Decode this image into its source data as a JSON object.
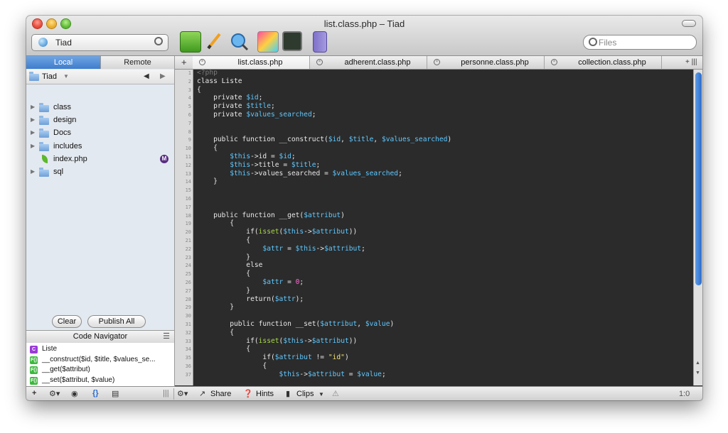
{
  "window": {
    "title": "list.class.php – Tiad"
  },
  "toolbar": {
    "site_name": "Tiad",
    "search_placeholder": "Files",
    "icons": [
      "leaf-icon",
      "pencil-icon",
      "preview-icon",
      "css-icon",
      "terminal-icon",
      "books-icon"
    ]
  },
  "sidebar": {
    "tabs": {
      "local": "Local",
      "remote": "Remote"
    },
    "path": "Tiad",
    "files": [
      {
        "name": "class",
        "kind": "folder"
      },
      {
        "name": "design",
        "kind": "folder"
      },
      {
        "name": "Docs",
        "kind": "folder"
      },
      {
        "name": "includes",
        "kind": "folder"
      },
      {
        "name": "index.php",
        "kind": "php",
        "badge": "M"
      },
      {
        "name": "sql",
        "kind": "folder"
      }
    ],
    "buttons": {
      "clear": "Clear",
      "publish": "Publish All"
    }
  },
  "navigator": {
    "title": "Code Navigator",
    "items": [
      {
        "badge": "C",
        "text": "Liste"
      },
      {
        "badge": "F()",
        "text": "__construct($id, $title, $values_se..."
      },
      {
        "badge": "F()",
        "text": "__get($attribut)"
      },
      {
        "badge": "F()",
        "text": "__set($attribut, $value)"
      }
    ]
  },
  "tabs": [
    {
      "label": "list.class.php",
      "active": true
    },
    {
      "label": "adherent.class.php",
      "active": false
    },
    {
      "label": "personne.class.php",
      "active": false
    },
    {
      "label": "collection.class.php",
      "active": false
    }
  ],
  "tabbar": {
    "add": "+",
    "overflow": "+ |||"
  },
  "code": {
    "lines": [
      [
        {
          "t": "<?php",
          "c": "dim"
        }
      ],
      [
        {
          "t": "class Liste",
          "c": "plain"
        }
      ],
      [
        {
          "t": "{",
          "c": "plain"
        }
      ],
      [
        {
          "t": "    private ",
          "c": "plain"
        },
        {
          "t": "$id",
          "c": "var"
        },
        {
          "t": ";",
          "c": "plain"
        }
      ],
      [
        {
          "t": "    private ",
          "c": "plain"
        },
        {
          "t": "$title",
          "c": "var"
        },
        {
          "t": ";",
          "c": "plain"
        }
      ],
      [
        {
          "t": "    private ",
          "c": "plain"
        },
        {
          "t": "$values_searched",
          "c": "var"
        },
        {
          "t": ";",
          "c": "plain"
        }
      ],
      [],
      [],
      [
        {
          "t": "    public function __construct(",
          "c": "plain"
        },
        {
          "t": "$id",
          "c": "var"
        },
        {
          "t": ", ",
          "c": "plain"
        },
        {
          "t": "$title",
          "c": "var"
        },
        {
          "t": ", ",
          "c": "plain"
        },
        {
          "t": "$values_searched",
          "c": "var"
        },
        {
          "t": ")",
          "c": "plain"
        }
      ],
      [
        {
          "t": "    {",
          "c": "plain"
        }
      ],
      [
        {
          "t": "        ",
          "c": "plain"
        },
        {
          "t": "$this",
          "c": "var"
        },
        {
          "t": "->id = ",
          "c": "plain"
        },
        {
          "t": "$id",
          "c": "var"
        },
        {
          "t": ";",
          "c": "plain"
        }
      ],
      [
        {
          "t": "        ",
          "c": "plain"
        },
        {
          "t": "$this",
          "c": "var"
        },
        {
          "t": "->title = ",
          "c": "plain"
        },
        {
          "t": "$title",
          "c": "var"
        },
        {
          "t": ";",
          "c": "plain"
        }
      ],
      [
        {
          "t": "        ",
          "c": "plain"
        },
        {
          "t": "$this",
          "c": "var"
        },
        {
          "t": "->values_searched = ",
          "c": "plain"
        },
        {
          "t": "$values_searched",
          "c": "var"
        },
        {
          "t": ";",
          "c": "plain"
        }
      ],
      [
        {
          "t": "    }",
          "c": "plain"
        }
      ],
      [],
      [],
      [],
      [
        {
          "t": "    public function __get(",
          "c": "plain"
        },
        {
          "t": "$attribut",
          "c": "var"
        },
        {
          "t": ")",
          "c": "plain"
        }
      ],
      [
        {
          "t": "        {",
          "c": "plain"
        }
      ],
      [
        {
          "t": "            if(",
          "c": "plain"
        },
        {
          "t": "isset",
          "c": "func"
        },
        {
          "t": "(",
          "c": "plain"
        },
        {
          "t": "$this",
          "c": "var"
        },
        {
          "t": "->",
          "c": "plain"
        },
        {
          "t": "$attribut",
          "c": "var"
        },
        {
          "t": "))",
          "c": "plain"
        }
      ],
      [
        {
          "t": "            {",
          "c": "plain"
        }
      ],
      [
        {
          "t": "                ",
          "c": "plain"
        },
        {
          "t": "$attr",
          "c": "var"
        },
        {
          "t": " = ",
          "c": "plain"
        },
        {
          "t": "$this",
          "c": "var"
        },
        {
          "t": "->",
          "c": "plain"
        },
        {
          "t": "$attribut",
          "c": "var"
        },
        {
          "t": ";",
          "c": "plain"
        }
      ],
      [
        {
          "t": "            }",
          "c": "plain"
        }
      ],
      [
        {
          "t": "            else",
          "c": "plain"
        }
      ],
      [
        {
          "t": "            {",
          "c": "plain"
        }
      ],
      [
        {
          "t": "                ",
          "c": "plain"
        },
        {
          "t": "$attr",
          "c": "var"
        },
        {
          "t": " = ",
          "c": "plain"
        },
        {
          "t": "0",
          "c": "num"
        },
        {
          "t": ";",
          "c": "plain"
        }
      ],
      [
        {
          "t": "            }",
          "c": "plain"
        }
      ],
      [
        {
          "t": "            return(",
          "c": "plain"
        },
        {
          "t": "$attr",
          "c": "var"
        },
        {
          "t": ");",
          "c": "plain"
        }
      ],
      [
        {
          "t": "        }",
          "c": "plain"
        }
      ],
      [],
      [
        {
          "t": "        public function __set(",
          "c": "plain"
        },
        {
          "t": "$attribut",
          "c": "var"
        },
        {
          "t": ", ",
          "c": "plain"
        },
        {
          "t": "$value",
          "c": "var"
        },
        {
          "t": ")",
          "c": "plain"
        }
      ],
      [
        {
          "t": "        {",
          "c": "plain"
        }
      ],
      [
        {
          "t": "            if(",
          "c": "plain"
        },
        {
          "t": "isset",
          "c": "func"
        },
        {
          "t": "(",
          "c": "plain"
        },
        {
          "t": "$this",
          "c": "var"
        },
        {
          "t": "->",
          "c": "plain"
        },
        {
          "t": "$attribut",
          "c": "var"
        },
        {
          "t": "))",
          "c": "plain"
        }
      ],
      [
        {
          "t": "            {",
          "c": "plain"
        }
      ],
      [
        {
          "t": "                if(",
          "c": "plain"
        },
        {
          "t": "$attribut",
          "c": "var"
        },
        {
          "t": " != ",
          "c": "plain"
        },
        {
          "t": "\"id\"",
          "c": "str"
        },
        {
          "t": ")",
          "c": "plain"
        }
      ],
      [
        {
          "t": "                {",
          "c": "plain"
        }
      ],
      [
        {
          "t": "                    ",
          "c": "plain"
        },
        {
          "t": "$this",
          "c": "var"
        },
        {
          "t": "->",
          "c": "plain"
        },
        {
          "t": "$attribut",
          "c": "var"
        },
        {
          "t": " = ",
          "c": "plain"
        },
        {
          "t": "$value",
          "c": "var"
        },
        {
          "t": ";",
          "c": "plain"
        }
      ]
    ]
  },
  "statusbar": {
    "share": "Share",
    "hints": "Hints",
    "clips": "Clips",
    "position": "1:0"
  },
  "colors": {
    "plain": "#e8e8e8",
    "var": "#5fc8ff",
    "func": "#a8d84a",
    "str": "#f0e070",
    "num": "#ff6ad5",
    "dim": "#7a7a7a",
    "accent": "#3f7ccc"
  }
}
